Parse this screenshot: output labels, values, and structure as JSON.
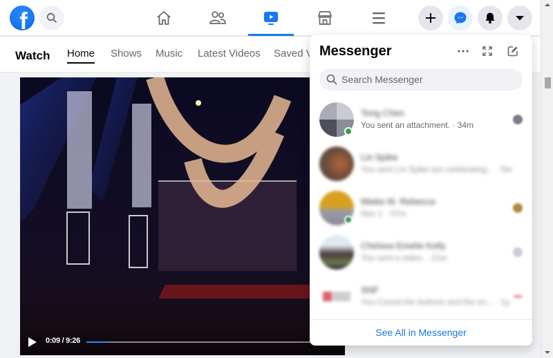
{
  "topbar": {
    "logo": "facebook-logo",
    "logo_letter": "f",
    "search_icon": "search-icon",
    "nav_tabs": [
      {
        "name": "home",
        "icon": "home-icon",
        "active": false
      },
      {
        "name": "friends",
        "icon": "friends-icon",
        "active": false
      },
      {
        "name": "watch",
        "icon": "video-icon",
        "active": true
      },
      {
        "name": "marketplace",
        "icon": "store-icon",
        "active": false
      },
      {
        "name": "menu",
        "icon": "hamburger-icon",
        "active": false
      }
    ],
    "right_buttons": [
      {
        "name": "create",
        "icon": "plus-icon"
      },
      {
        "name": "messenger",
        "icon": "messenger-icon",
        "active": true
      },
      {
        "name": "notifications",
        "icon": "bell-icon"
      },
      {
        "name": "account",
        "icon": "caret-down-icon"
      }
    ]
  },
  "watch": {
    "title": "Watch",
    "tabs": [
      {
        "label": "Home",
        "active": true
      },
      {
        "label": "Shows",
        "active": false
      },
      {
        "label": "Music",
        "active": false
      },
      {
        "label": "Latest Videos",
        "active": false
      },
      {
        "label": "Saved Videos",
        "active": false
      }
    ]
  },
  "video": {
    "current_time": "0:09",
    "duration": "9:26",
    "time_label": "0:09 / 9:26",
    "progress_percent": 1.6
  },
  "messenger": {
    "title": "Messenger",
    "actions": [
      {
        "name": "options",
        "icon": "more-icon"
      },
      {
        "name": "expand",
        "icon": "expand-icon"
      },
      {
        "name": "new-message",
        "icon": "compose-icon"
      }
    ],
    "search_placeholder": "Search Messenger",
    "chats": [
      {
        "name": "Tong Chen",
        "preview": "You sent an attachment. · 34m",
        "online": true,
        "blurred_name": true,
        "blurred_preview": false
      },
      {
        "name": "Lin Spike",
        "preview": "You sent Lin Spike are celebrating... · 5hr",
        "online": false,
        "blurred_name": true,
        "blurred_preview": true
      },
      {
        "name": "Mieke M. Rebecca",
        "preview": "Nov 1 · 37m",
        "online": true,
        "blurred_name": true,
        "blurred_preview": true
      },
      {
        "name": "Chelsea Emelie Kelly",
        "preview": "You sent a video. · 21w",
        "online": false,
        "blurred_name": true,
        "blurred_preview": true
      },
      {
        "name": "SNF",
        "preview": "You Cound the buttons and the en... · 1y",
        "online": false,
        "blurred_name": true,
        "blurred_preview": true
      }
    ],
    "see_all_label": "See All in Messenger"
  },
  "colors": {
    "brand": "#1877f2",
    "link": "#1b74e4",
    "online": "#31a24c"
  }
}
